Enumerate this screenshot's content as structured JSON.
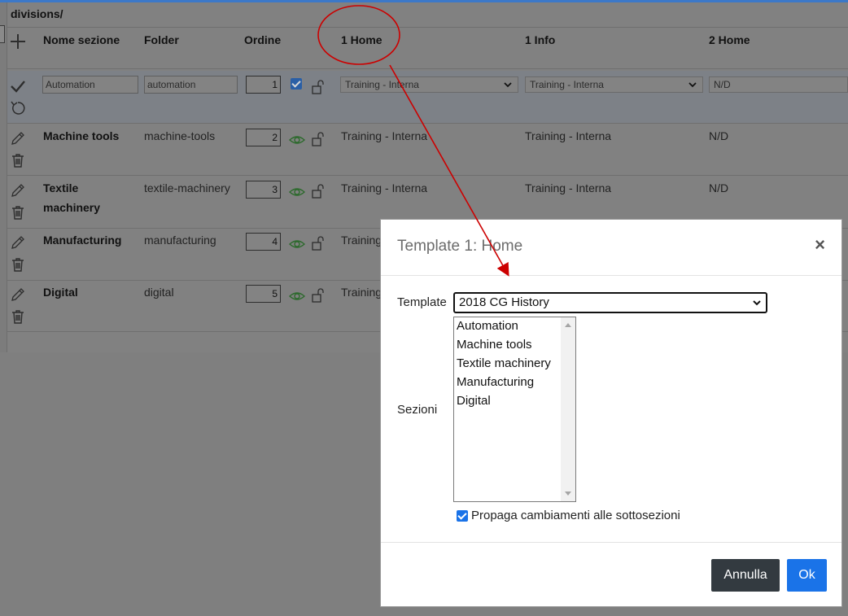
{
  "breadcrumb": "divisions/",
  "table": {
    "headers": [
      "Nome sezione",
      "Folder",
      "Ordine",
      "1 Home",
      "1 Info",
      "2 Home"
    ],
    "edit_row": {
      "nome": "Automation",
      "folder": "automation",
      "ordine": "1",
      "home1": "Training - Interna",
      "info1": "Training - Interna",
      "home2": "N/D"
    },
    "rows": [
      {
        "nome": "Machine tools",
        "folder": "machine-tools",
        "ordine": "2",
        "home1": "Training - Interna",
        "info1": "Training - Interna",
        "home2": "N/D"
      },
      {
        "nome": "Textile machinery",
        "folder": "textile-machinery",
        "ordine": "3",
        "home1": "Training - Interna",
        "info1": "Training - Interna",
        "home2": "N/D"
      },
      {
        "nome": "Manufacturing",
        "folder": "manufacturing",
        "ordine": "4",
        "home1": "Training",
        "info1": "",
        "home2": ""
      },
      {
        "nome": "Digital",
        "folder": "digital",
        "ordine": "5",
        "home1": "Training",
        "info1": "",
        "home2": ""
      }
    ]
  },
  "modal": {
    "title": "Template 1: Home",
    "close": "×",
    "template_label": "Template",
    "template_value": "2018 CG History",
    "sezioni_label": "Sezioni",
    "sezioni_options": [
      "Automation",
      "Machine tools",
      "Textile machinery",
      "Manufacturing",
      "Digital"
    ],
    "propaga_label": "Propaga cambiamenti alle sottosezioni",
    "cancel_label": "Annulla",
    "ok_label": "Ok"
  },
  "icons": {
    "add": "plus-icon",
    "confirm": "check-icon",
    "undo": "undo-icon",
    "edit": "pencil-icon",
    "delete": "trash-icon",
    "visible": "eye-icon",
    "unlock": "unlock-icon"
  },
  "colors": {
    "topbar": "#3c78c8",
    "overlay": "#7f7f7f",
    "ok_button": "#1a73e8",
    "cancel_button": "#333a40",
    "annotation": "#cc0000"
  }
}
